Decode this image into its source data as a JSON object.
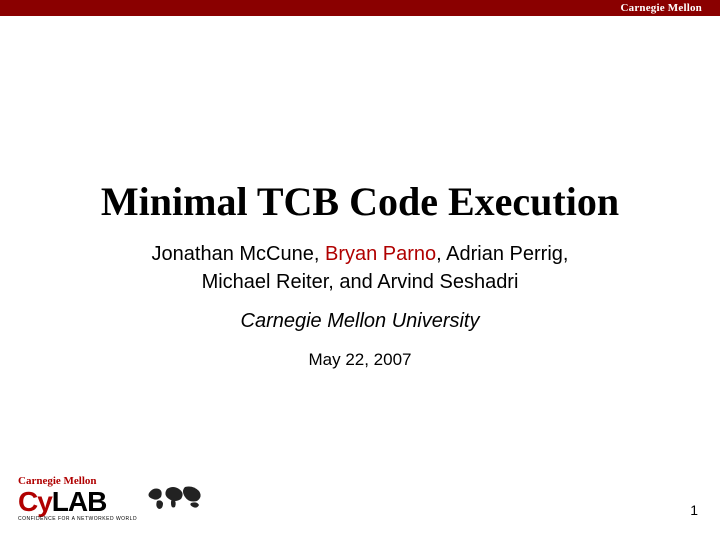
{
  "header": {
    "brand": "Carnegie Mellon"
  },
  "title": "Minimal TCB Code Execution",
  "authors": {
    "line1_pre": "Jonathan McCune, ",
    "line1_highlight": "Bryan Parno",
    "line1_post": ", Adrian Perrig,",
    "line2": "Michael Reiter, and Arvind Seshadri"
  },
  "affiliation": "Carnegie Mellon University",
  "date": "May 22, 2007",
  "footer": {
    "logo_top": "Carnegie Mellon",
    "logo_main_cy": "Cy",
    "logo_main_lab": "LAB",
    "logo_tag": "CONFIDENCE FOR A NETWORKED WORLD"
  },
  "page_number": "1"
}
